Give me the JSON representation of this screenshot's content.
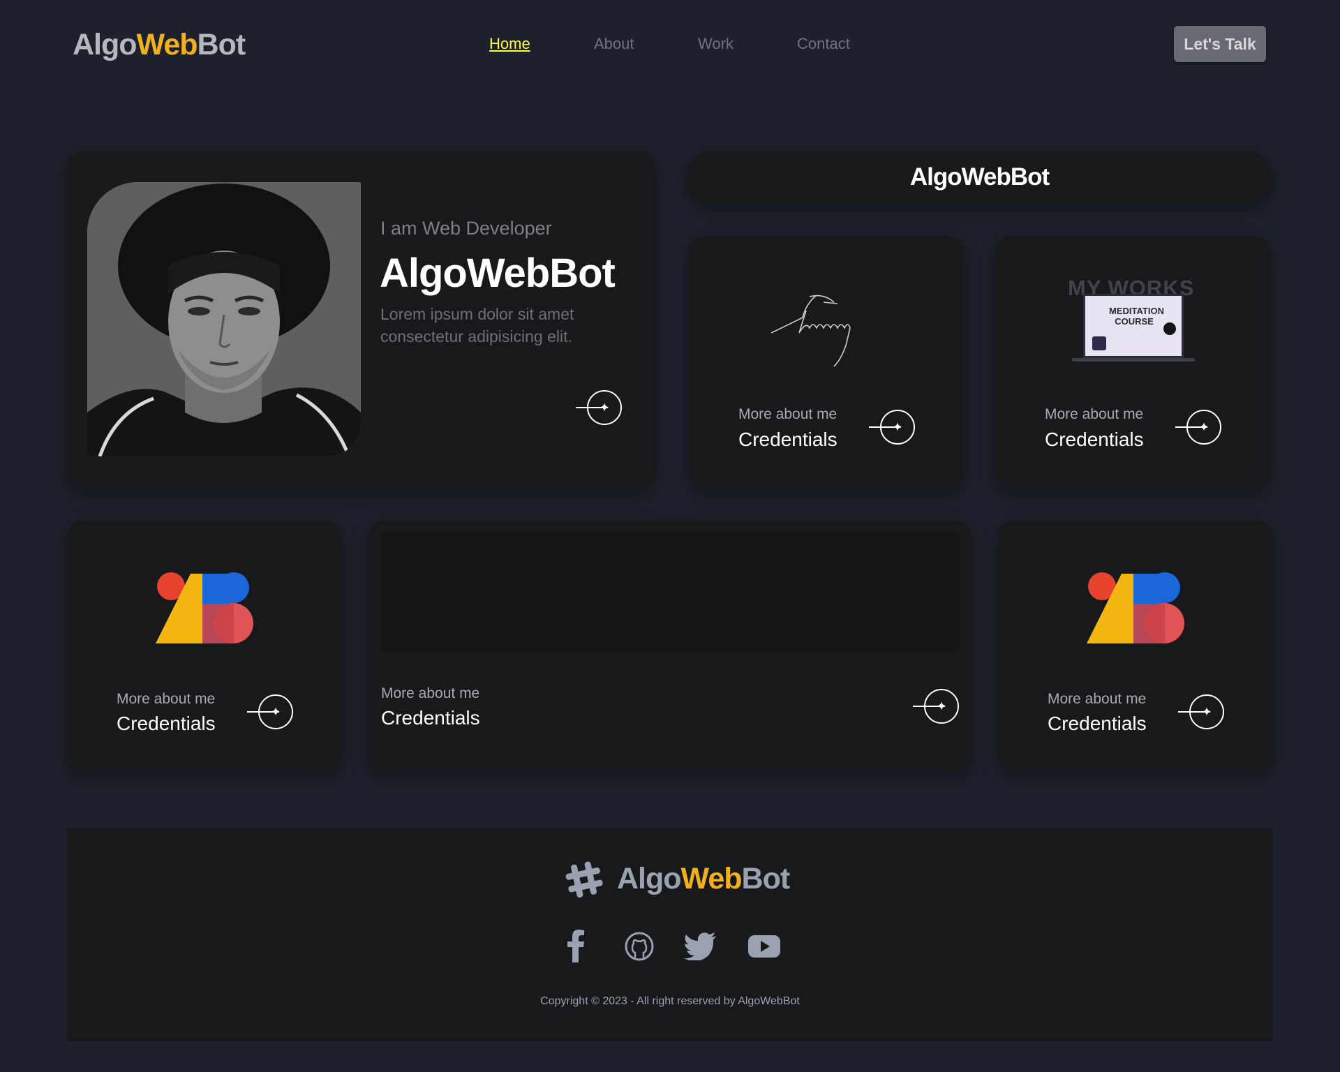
{
  "header": {
    "logo_part1": "Algo",
    "logo_part2": "Web",
    "logo_part3": "Bot",
    "nav": [
      "Home",
      "About",
      "Work",
      "Contact"
    ],
    "cta": "Let's Talk"
  },
  "hero": {
    "subtitle": "I am Web Developer",
    "title": "AlgoWebBot",
    "line1": "Lorem ipsum dolor sit amet",
    "line2": "consectetur adipisicing elit."
  },
  "banner": {
    "title": "AlgoWebBot"
  },
  "cards": [
    {
      "small": "More about me",
      "big": "Credentials",
      "image": "signature"
    },
    {
      "small": "More about me",
      "big": "Credentials",
      "image": "my-works-laptop",
      "image_text": [
        "MY WORKS",
        "MEDITATION",
        "COURSE"
      ]
    },
    {
      "small": "More about me",
      "big": "Credentials",
      "image": "abstract-logo"
    },
    {
      "small": "More about me",
      "big": "Credentials",
      "image": "dark-texture"
    },
    {
      "small": "More about me",
      "big": "Credentials",
      "image": "abstract-logo"
    }
  ],
  "footer": {
    "logo_part1": "Algo",
    "logo_part2": "Web",
    "logo_part3": "Bot",
    "social": [
      "facebook-icon",
      "github-icon",
      "twitter-icon",
      "youtube-icon"
    ],
    "copyright": "Copyright © 2023 - All right reserved by AlgoWebBot"
  },
  "colors": {
    "background": "#1c212b",
    "card": "#18191b",
    "accent": "#f2b01e",
    "active_nav": "#ffff3b"
  }
}
